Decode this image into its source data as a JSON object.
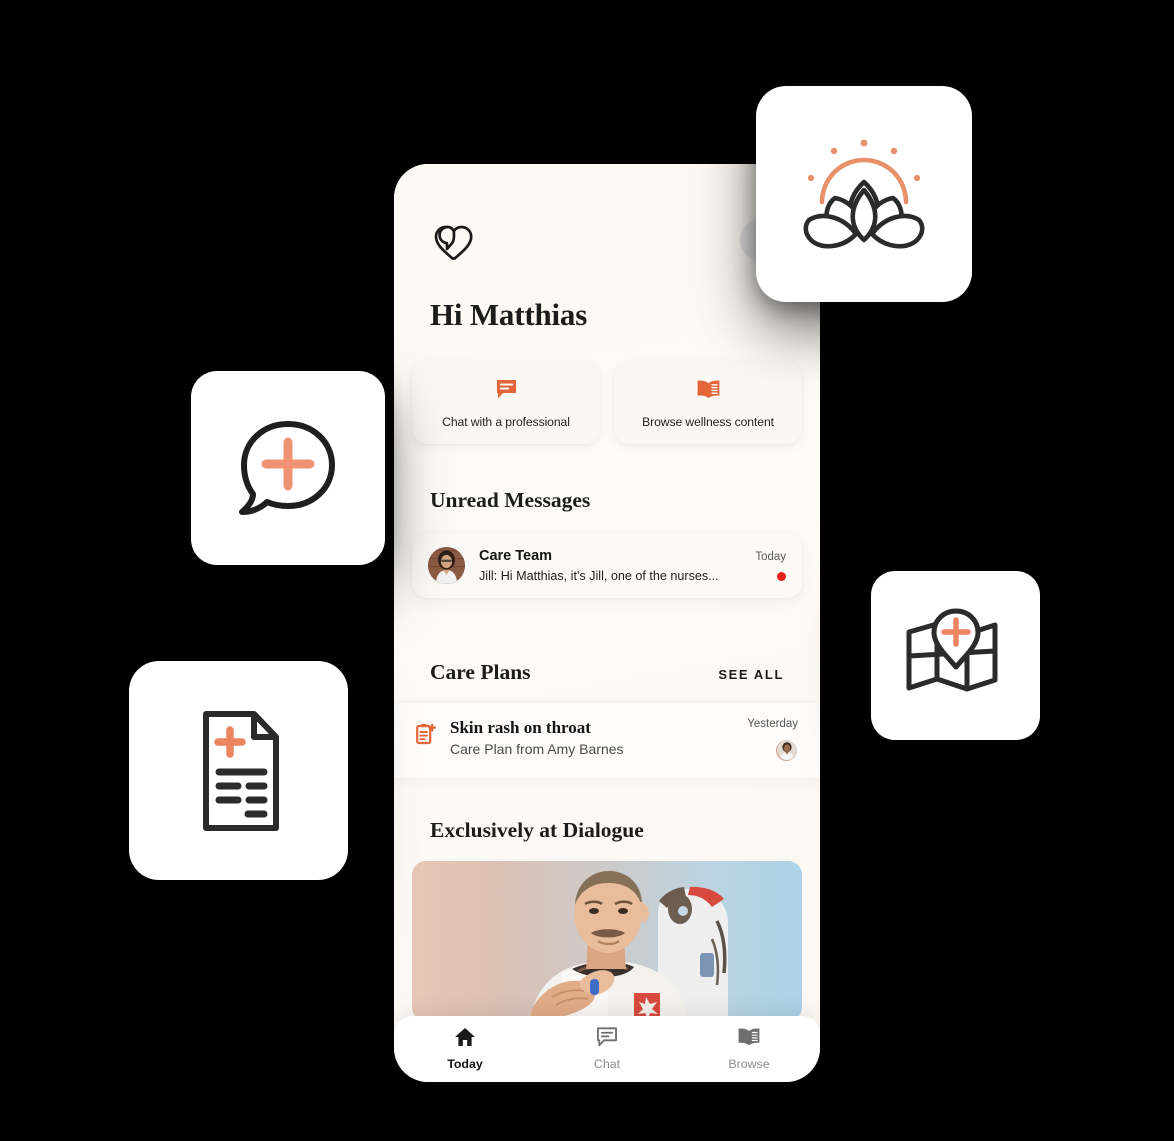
{
  "app": {
    "brand": "Dialogue",
    "logo_icon": "heart-chat-logo",
    "accent_color": "#E2663A",
    "unread_dot_color": "#E8201C",
    "background_color": "#FDFAF6",
    "canvas_color": "#000000"
  },
  "header": {
    "greeting": "Hi Matthias",
    "avatar_button_icon": "profile-avatar-icon"
  },
  "quick_actions": [
    {
      "label": "Chat with a professional",
      "icon": "chat-bubble-icon"
    },
    {
      "label": "Browse wellness content",
      "icon": "open-book-icon"
    }
  ],
  "unread_messages": {
    "title": "Unread Messages",
    "items": [
      {
        "name": "Care Team",
        "time": "Today",
        "preview": "Jill: Hi Matthias, it's Jill, one of the nurses...",
        "avatar_icon": "nurse-avatar-photo",
        "unread": true
      }
    ]
  },
  "care_plans": {
    "title": "Care Plans",
    "see_all_label": "SEE ALL",
    "items": [
      {
        "title": "Skin rash on throat",
        "subtitle": "Care Plan from Amy Barnes",
        "date": "Yesterday",
        "icon": "care-plan-document-icon",
        "avatar_icon": "provider-avatar-photo"
      }
    ]
  },
  "exclusive": {
    "title": "Exclusively at Dialogue",
    "hero_icon": "astronaut-photo"
  },
  "tabbar": {
    "tabs": [
      {
        "label": "Today",
        "icon": "home-icon",
        "active": true
      },
      {
        "label": "Chat",
        "icon": "chat-bubble-icon",
        "active": false
      },
      {
        "label": "Browse",
        "icon": "open-book-icon",
        "active": false
      }
    ]
  },
  "floating_cards": [
    {
      "icon": "lotus-sunrise-icon",
      "name": "wellness"
    },
    {
      "icon": "chat-bubble-plus-icon",
      "name": "consult"
    },
    {
      "icon": "medical-document-icon",
      "name": "records"
    },
    {
      "icon": "map-pin-medical-icon",
      "name": "clinics"
    }
  ]
}
